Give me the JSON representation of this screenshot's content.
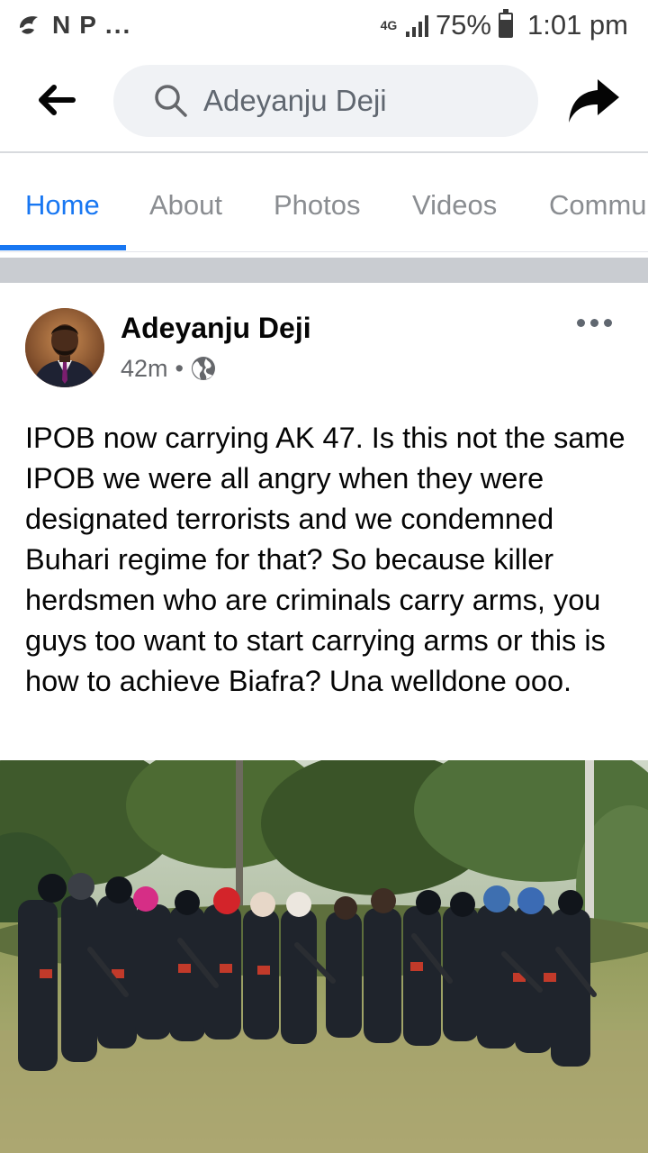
{
  "status_bar": {
    "app_glyph_1": "N",
    "app_glyph_2": "P",
    "overflow": "...",
    "network": "4G",
    "battery_pct": "75%",
    "battery_level": 0.75,
    "time": "1:01 pm"
  },
  "search": {
    "query": "Adeyanju Deji",
    "icons": {
      "back": "back-arrow-icon",
      "search": "search-icon",
      "share": "share-icon"
    }
  },
  "tabs": [
    {
      "label": "Home",
      "active": true
    },
    {
      "label": "About",
      "active": false
    },
    {
      "label": "Photos",
      "active": false
    },
    {
      "label": "Videos",
      "active": false
    },
    {
      "label": "Commu",
      "active": false
    }
  ],
  "post": {
    "author": "Adeyanju Deji",
    "time": "42m",
    "separator": "•",
    "audience_icon": "globe-icon",
    "text": "IPOB now carrying AK 47. Is this not the same IPOB we were all angry when they were designated terrorists and we condemned Buhari regime for that? So because killer herdsmen who are criminals carry arms, you guys too want to start carrying arms or this is how to achieve Biafra? Una welldone ooo."
  },
  "colors": {
    "accent": "#1877f2",
    "tab_inactive": "#8a8d91",
    "search_bg": "#f0f2f5",
    "separator": "#c9ccd1",
    "text": "#050505"
  }
}
